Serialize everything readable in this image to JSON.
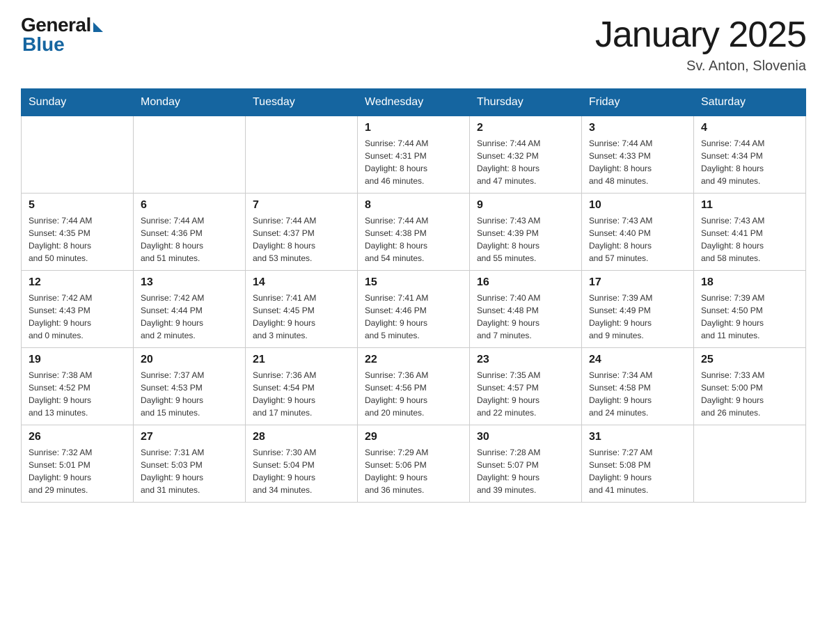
{
  "logo": {
    "general": "General",
    "blue": "Blue"
  },
  "header": {
    "month": "January 2025",
    "location": "Sv. Anton, Slovenia"
  },
  "days_of_week": [
    "Sunday",
    "Monday",
    "Tuesday",
    "Wednesday",
    "Thursday",
    "Friday",
    "Saturday"
  ],
  "weeks": [
    [
      {
        "day": "",
        "info": ""
      },
      {
        "day": "",
        "info": ""
      },
      {
        "day": "",
        "info": ""
      },
      {
        "day": "1",
        "info": "Sunrise: 7:44 AM\nSunset: 4:31 PM\nDaylight: 8 hours\nand 46 minutes."
      },
      {
        "day": "2",
        "info": "Sunrise: 7:44 AM\nSunset: 4:32 PM\nDaylight: 8 hours\nand 47 minutes."
      },
      {
        "day": "3",
        "info": "Sunrise: 7:44 AM\nSunset: 4:33 PM\nDaylight: 8 hours\nand 48 minutes."
      },
      {
        "day": "4",
        "info": "Sunrise: 7:44 AM\nSunset: 4:34 PM\nDaylight: 8 hours\nand 49 minutes."
      }
    ],
    [
      {
        "day": "5",
        "info": "Sunrise: 7:44 AM\nSunset: 4:35 PM\nDaylight: 8 hours\nand 50 minutes."
      },
      {
        "day": "6",
        "info": "Sunrise: 7:44 AM\nSunset: 4:36 PM\nDaylight: 8 hours\nand 51 minutes."
      },
      {
        "day": "7",
        "info": "Sunrise: 7:44 AM\nSunset: 4:37 PM\nDaylight: 8 hours\nand 53 minutes."
      },
      {
        "day": "8",
        "info": "Sunrise: 7:44 AM\nSunset: 4:38 PM\nDaylight: 8 hours\nand 54 minutes."
      },
      {
        "day": "9",
        "info": "Sunrise: 7:43 AM\nSunset: 4:39 PM\nDaylight: 8 hours\nand 55 minutes."
      },
      {
        "day": "10",
        "info": "Sunrise: 7:43 AM\nSunset: 4:40 PM\nDaylight: 8 hours\nand 57 minutes."
      },
      {
        "day": "11",
        "info": "Sunrise: 7:43 AM\nSunset: 4:41 PM\nDaylight: 8 hours\nand 58 minutes."
      }
    ],
    [
      {
        "day": "12",
        "info": "Sunrise: 7:42 AM\nSunset: 4:43 PM\nDaylight: 9 hours\nand 0 minutes."
      },
      {
        "day": "13",
        "info": "Sunrise: 7:42 AM\nSunset: 4:44 PM\nDaylight: 9 hours\nand 2 minutes."
      },
      {
        "day": "14",
        "info": "Sunrise: 7:41 AM\nSunset: 4:45 PM\nDaylight: 9 hours\nand 3 minutes."
      },
      {
        "day": "15",
        "info": "Sunrise: 7:41 AM\nSunset: 4:46 PM\nDaylight: 9 hours\nand 5 minutes."
      },
      {
        "day": "16",
        "info": "Sunrise: 7:40 AM\nSunset: 4:48 PM\nDaylight: 9 hours\nand 7 minutes."
      },
      {
        "day": "17",
        "info": "Sunrise: 7:39 AM\nSunset: 4:49 PM\nDaylight: 9 hours\nand 9 minutes."
      },
      {
        "day": "18",
        "info": "Sunrise: 7:39 AM\nSunset: 4:50 PM\nDaylight: 9 hours\nand 11 minutes."
      }
    ],
    [
      {
        "day": "19",
        "info": "Sunrise: 7:38 AM\nSunset: 4:52 PM\nDaylight: 9 hours\nand 13 minutes."
      },
      {
        "day": "20",
        "info": "Sunrise: 7:37 AM\nSunset: 4:53 PM\nDaylight: 9 hours\nand 15 minutes."
      },
      {
        "day": "21",
        "info": "Sunrise: 7:36 AM\nSunset: 4:54 PM\nDaylight: 9 hours\nand 17 minutes."
      },
      {
        "day": "22",
        "info": "Sunrise: 7:36 AM\nSunset: 4:56 PM\nDaylight: 9 hours\nand 20 minutes."
      },
      {
        "day": "23",
        "info": "Sunrise: 7:35 AM\nSunset: 4:57 PM\nDaylight: 9 hours\nand 22 minutes."
      },
      {
        "day": "24",
        "info": "Sunrise: 7:34 AM\nSunset: 4:58 PM\nDaylight: 9 hours\nand 24 minutes."
      },
      {
        "day": "25",
        "info": "Sunrise: 7:33 AM\nSunset: 5:00 PM\nDaylight: 9 hours\nand 26 minutes."
      }
    ],
    [
      {
        "day": "26",
        "info": "Sunrise: 7:32 AM\nSunset: 5:01 PM\nDaylight: 9 hours\nand 29 minutes."
      },
      {
        "day": "27",
        "info": "Sunrise: 7:31 AM\nSunset: 5:03 PM\nDaylight: 9 hours\nand 31 minutes."
      },
      {
        "day": "28",
        "info": "Sunrise: 7:30 AM\nSunset: 5:04 PM\nDaylight: 9 hours\nand 34 minutes."
      },
      {
        "day": "29",
        "info": "Sunrise: 7:29 AM\nSunset: 5:06 PM\nDaylight: 9 hours\nand 36 minutes."
      },
      {
        "day": "30",
        "info": "Sunrise: 7:28 AM\nSunset: 5:07 PM\nDaylight: 9 hours\nand 39 minutes."
      },
      {
        "day": "31",
        "info": "Sunrise: 7:27 AM\nSunset: 5:08 PM\nDaylight: 9 hours\nand 41 minutes."
      },
      {
        "day": "",
        "info": ""
      }
    ]
  ]
}
